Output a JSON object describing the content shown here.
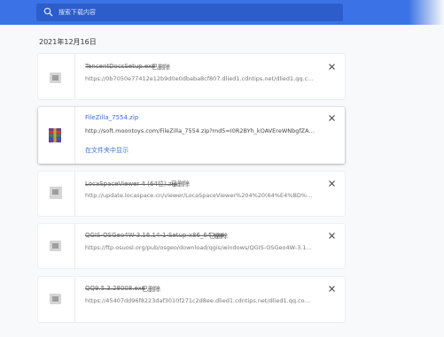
{
  "search": {
    "placeholder": "搜索下载内容"
  },
  "date_header": "2021年12月16日",
  "downloads": [
    {
      "file_name": "TencentDocsSetup.exe",
      "status": "已删除",
      "url": "https://0b7050e77412e12b9d0e0dbaba8cf807.dlied1.cdntips.net/dlied1.qq.com/qq..."
    },
    {
      "file_name": "FileZilla_7554.zip",
      "status": "",
      "url": "http://soft.moontoys.com/FileZilla_7554.zip?md5=I0R2BYh_kOAVEreWNbgfZA&expir...",
      "action": "在文件夹中显示"
    },
    {
      "file_name": "LocaSpaceViewer 4 (64位).zip",
      "status": "已删除",
      "url": "http://update.locaspace.cn/viewer/LocaSpaceViewer%204%20(64%E4%BD%8D).zip?..."
    },
    {
      "file_name": "QGIS-OSGeo4W-3.16.14-1-Setup-x86_64.exe",
      "status": "已删除",
      "url": "https://ftp.osuosl.org/pub/osgeo/download/qgis/windows/QGIS-OSGeo4W-3.16.14-..."
    },
    {
      "file_name": "QQ9.5.3.28008.exe",
      "status": "已删除",
      "url": "https://45407dd96f8223daf3010f271c2d8ee.dlied1.cdntips.net/dlied1.qq.com/qqw..."
    }
  ]
}
